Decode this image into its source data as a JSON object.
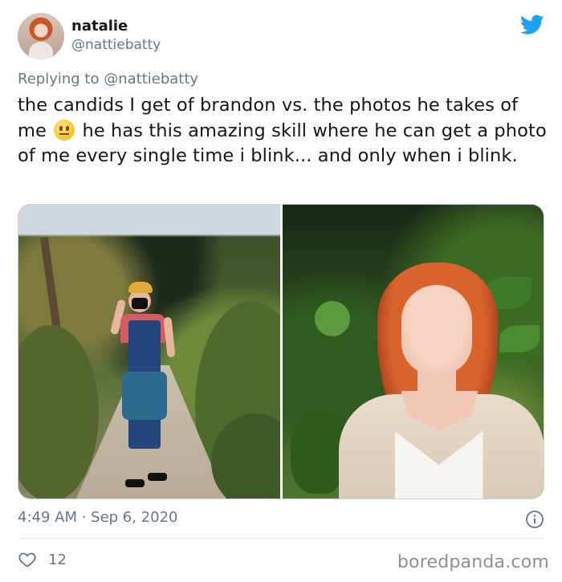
{
  "author": {
    "name": "natalie",
    "handle": "@nattiebatty"
  },
  "reply": {
    "prefix": "Replying to",
    "mention": "@nattiebatty"
  },
  "tweet": {
    "text_part1": "the candids I get of brandon vs. the photos he takes of me",
    "text_part2": "he has this amazing skill where he can get a photo of me every single time i blink... and only when i blink.",
    "emoji": "neutral-face-emoji"
  },
  "media": [
    {
      "icon": "photo-man-on-garden-path"
    },
    {
      "icon": "photo-woman-red-hair-blinking"
    }
  ],
  "meta": {
    "timestamp": "4:49 AM · Sep 6, 2020"
  },
  "actions": {
    "likes": "12"
  },
  "watermark": "boredpanda.com",
  "colors": {
    "twitter_blue": "#1da1f2",
    "secondary_text": "#657786",
    "primary_text": "#14171a"
  }
}
